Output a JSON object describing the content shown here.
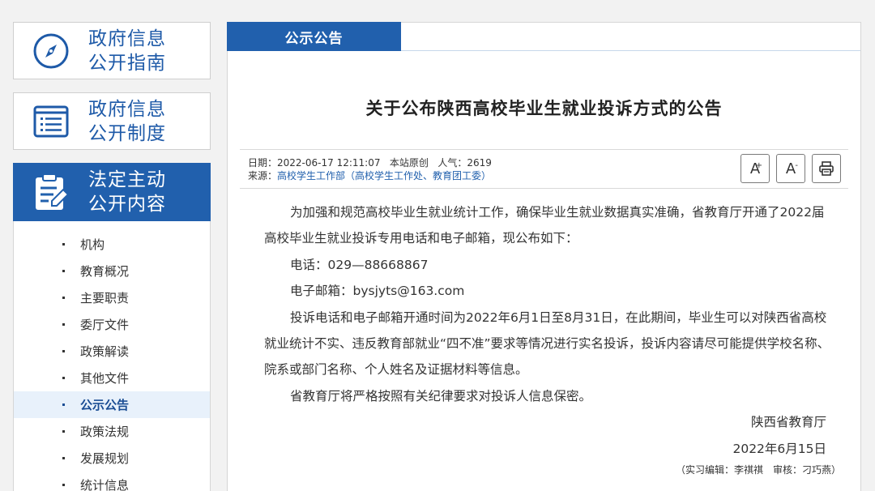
{
  "sidebar": {
    "cards": [
      {
        "line1": "政府信息",
        "line2": "公开指南",
        "icon": "compass-icon"
      },
      {
        "line1": "政府信息",
        "line2": "公开制度",
        "icon": "list-icon"
      },
      {
        "line1": "法定主动",
        "line2": "公开内容",
        "icon": "clipboard-edit-icon"
      }
    ],
    "menu": [
      {
        "label": "机构"
      },
      {
        "label": "教育概况"
      },
      {
        "label": "主要职责"
      },
      {
        "label": "委厅文件"
      },
      {
        "label": "政策解读"
      },
      {
        "label": "其他文件"
      },
      {
        "label": "公示公告"
      },
      {
        "label": "政策法规"
      },
      {
        "label": "发展规划"
      },
      {
        "label": "统计信息"
      }
    ]
  },
  "panel": {
    "tab": "公示公告",
    "title": "关于公布陕西高校毕业生就业投诉方式的公告",
    "meta": {
      "date_label": "日期：",
      "date": "2022-06-17 12:11:07",
      "origin": "本站原创",
      "views_label": "人气：",
      "views": "2619",
      "source_label": "来源：",
      "source": "高校学生工作部（高校学生工作处、教育团工委）"
    },
    "tools": {
      "font_up": "A",
      "font_up_sup": "+",
      "font_down": "A",
      "font_down_sup": "-"
    },
    "paragraphs": [
      "为加强和规范高校毕业生就业统计工作，确保毕业生就业数据真实准确，省教育厅开通了2022届高校毕业生就业投诉专用电话和电子邮箱，现公布如下：",
      "电话：029—88668867",
      "电子邮箱：bysjyts@163.com",
      "投诉电话和电子邮箱开通时间为2022年6月1日至8月31日，在此期间，毕业生可以对陕西省高校就业统计不实、违反教育部就业“四不准”要求等情况进行实名投诉，投诉内容请尽可能提供学校名称、院系或部门名称、个人姓名及证据材料等信息。",
      "省教育厅将严格按照有关纪律要求对投诉人信息保密。"
    ],
    "signature": "陕西省教育厅",
    "sign_date": "2022年6月15日",
    "footnote": "（实习编辑：李祺祺　审核：刁巧燕）"
  }
}
